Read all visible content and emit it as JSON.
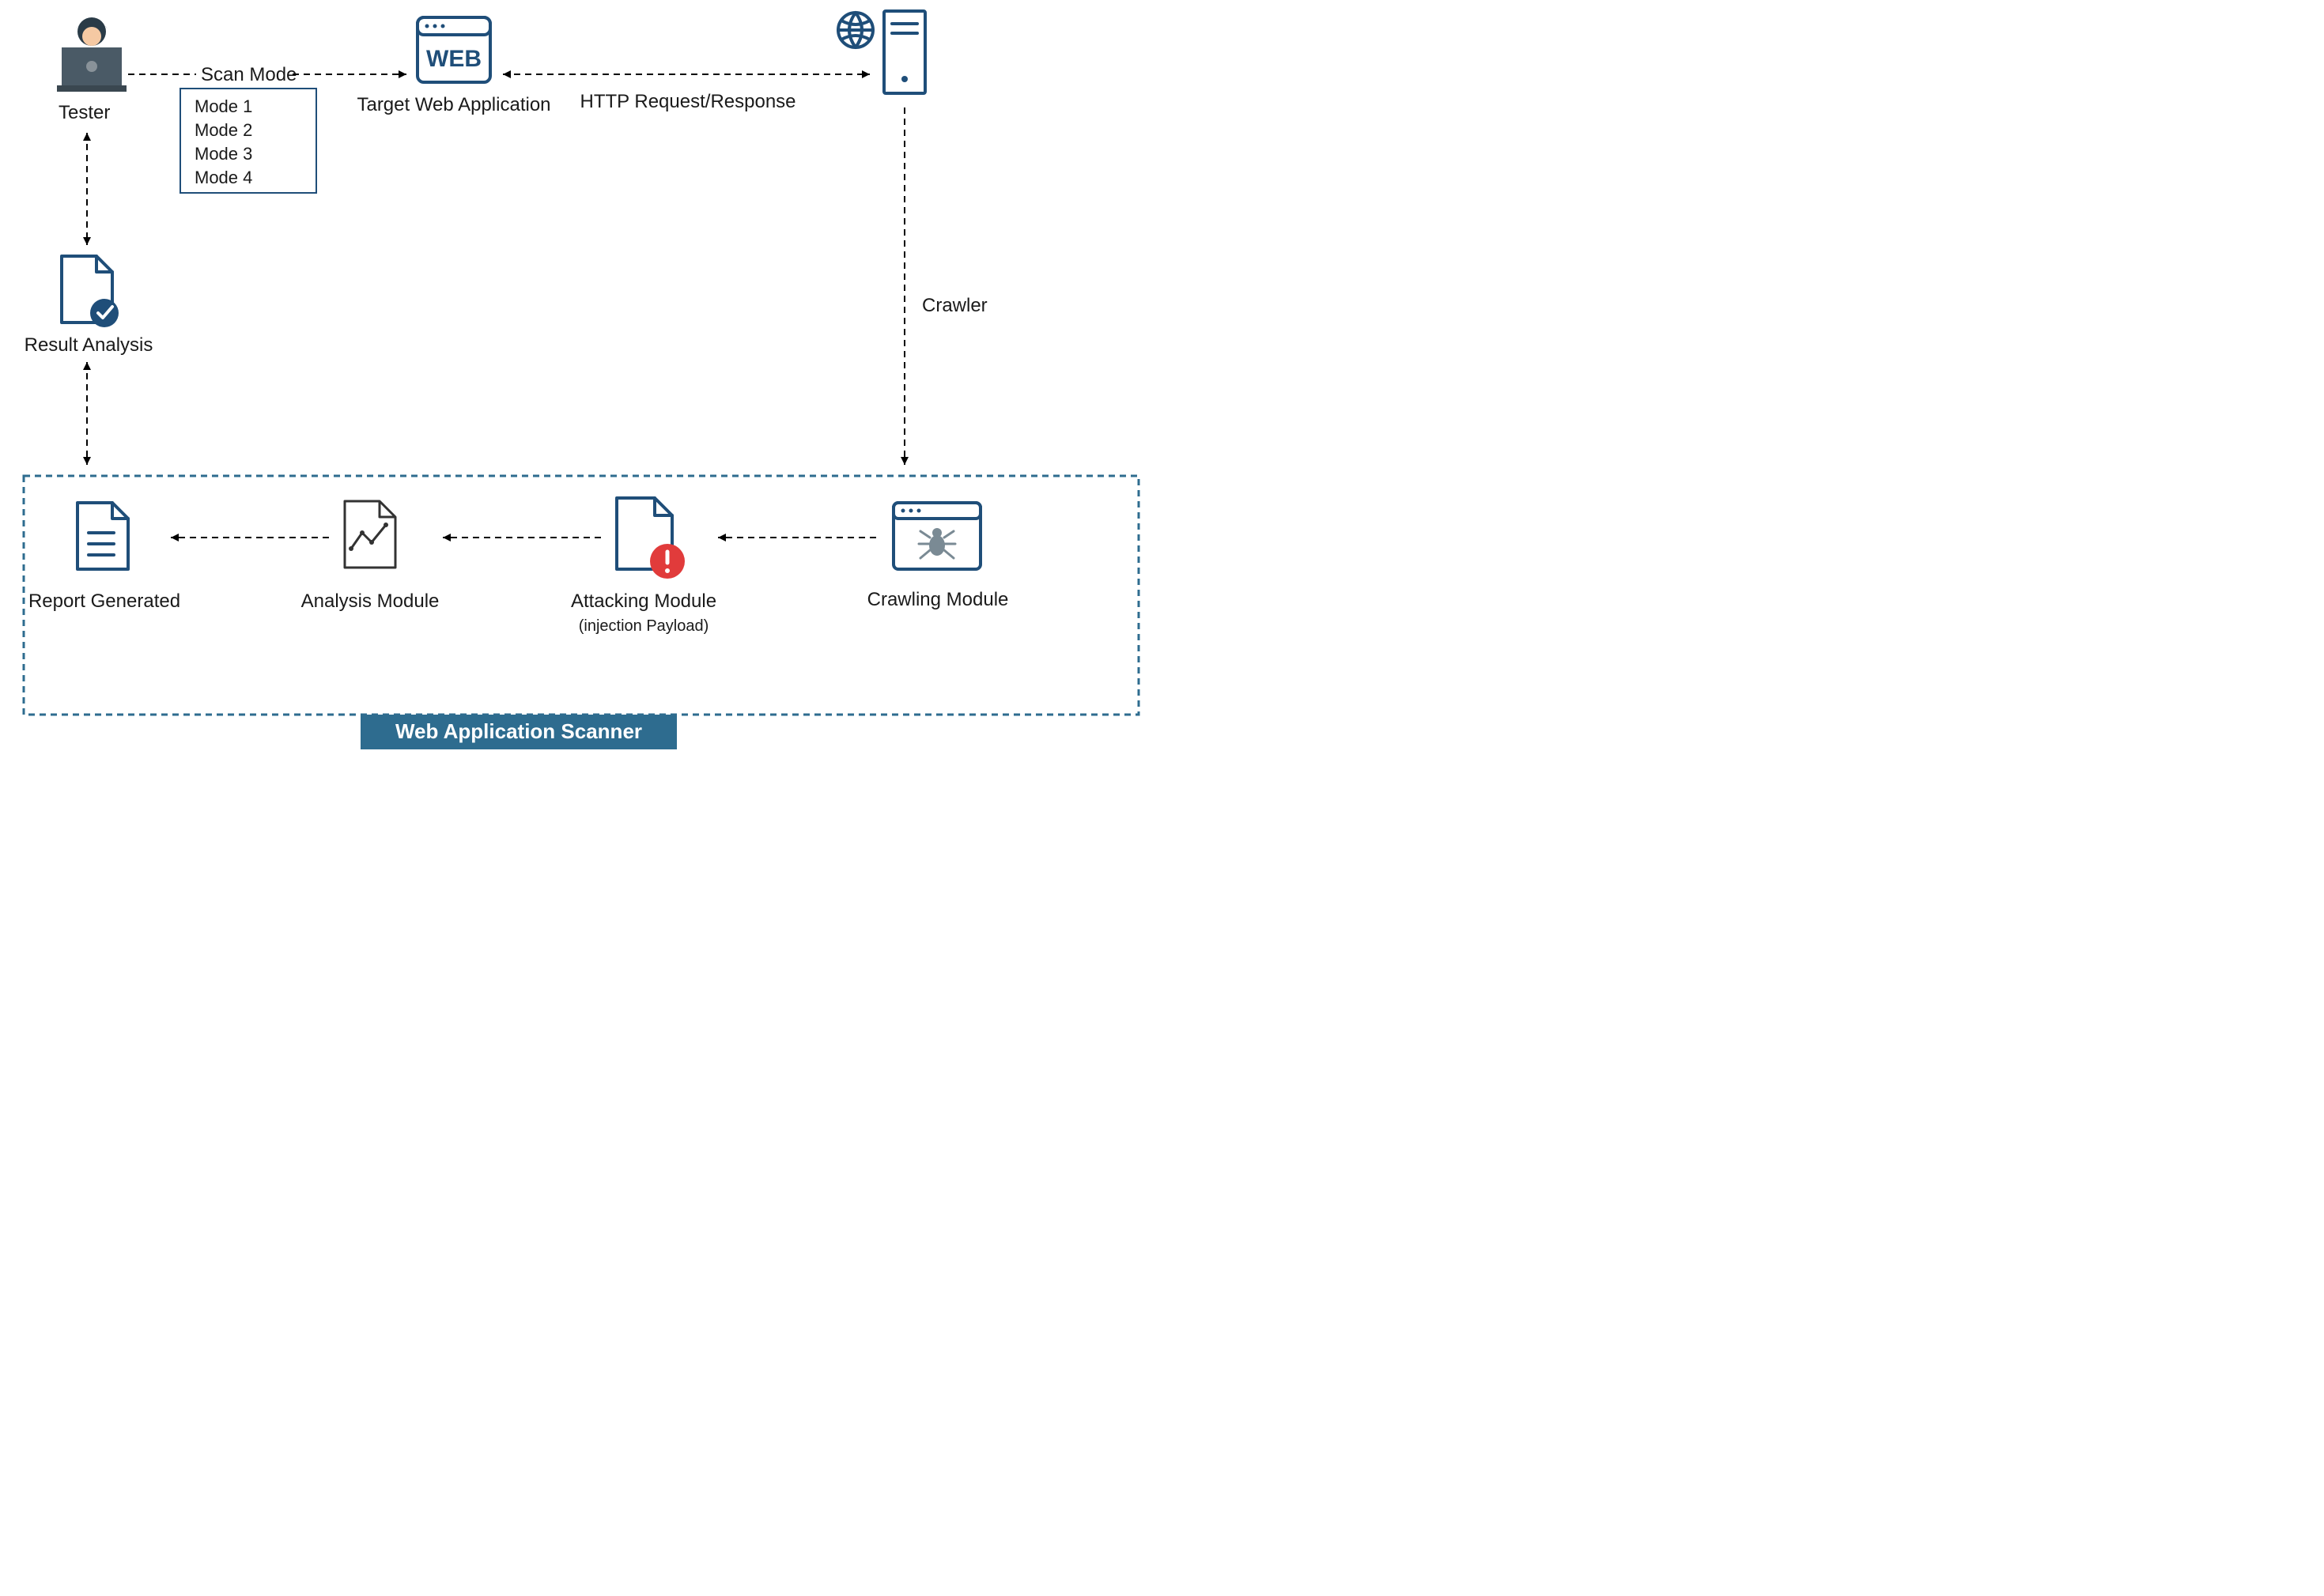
{
  "nodes": {
    "tester": "Tester",
    "target": "Target Web Application",
    "result": "Result Analysis",
    "report": "Report Generated",
    "analysis": "Analysis Module",
    "attacking": "Attacking Module",
    "attacking_sub": "(injection Payload)",
    "crawling": "Crawling Module"
  },
  "edges": {
    "scan": "Scan Mode",
    "http": "HTTP Request/Response",
    "crawler": "Crawler"
  },
  "modes": {
    "m1": "Mode 1",
    "m2": "Mode 2",
    "m3": "Mode 3",
    "m4": "Mode 4"
  },
  "web_icon_text": "WEB",
  "banner": "Web Application Scanner"
}
